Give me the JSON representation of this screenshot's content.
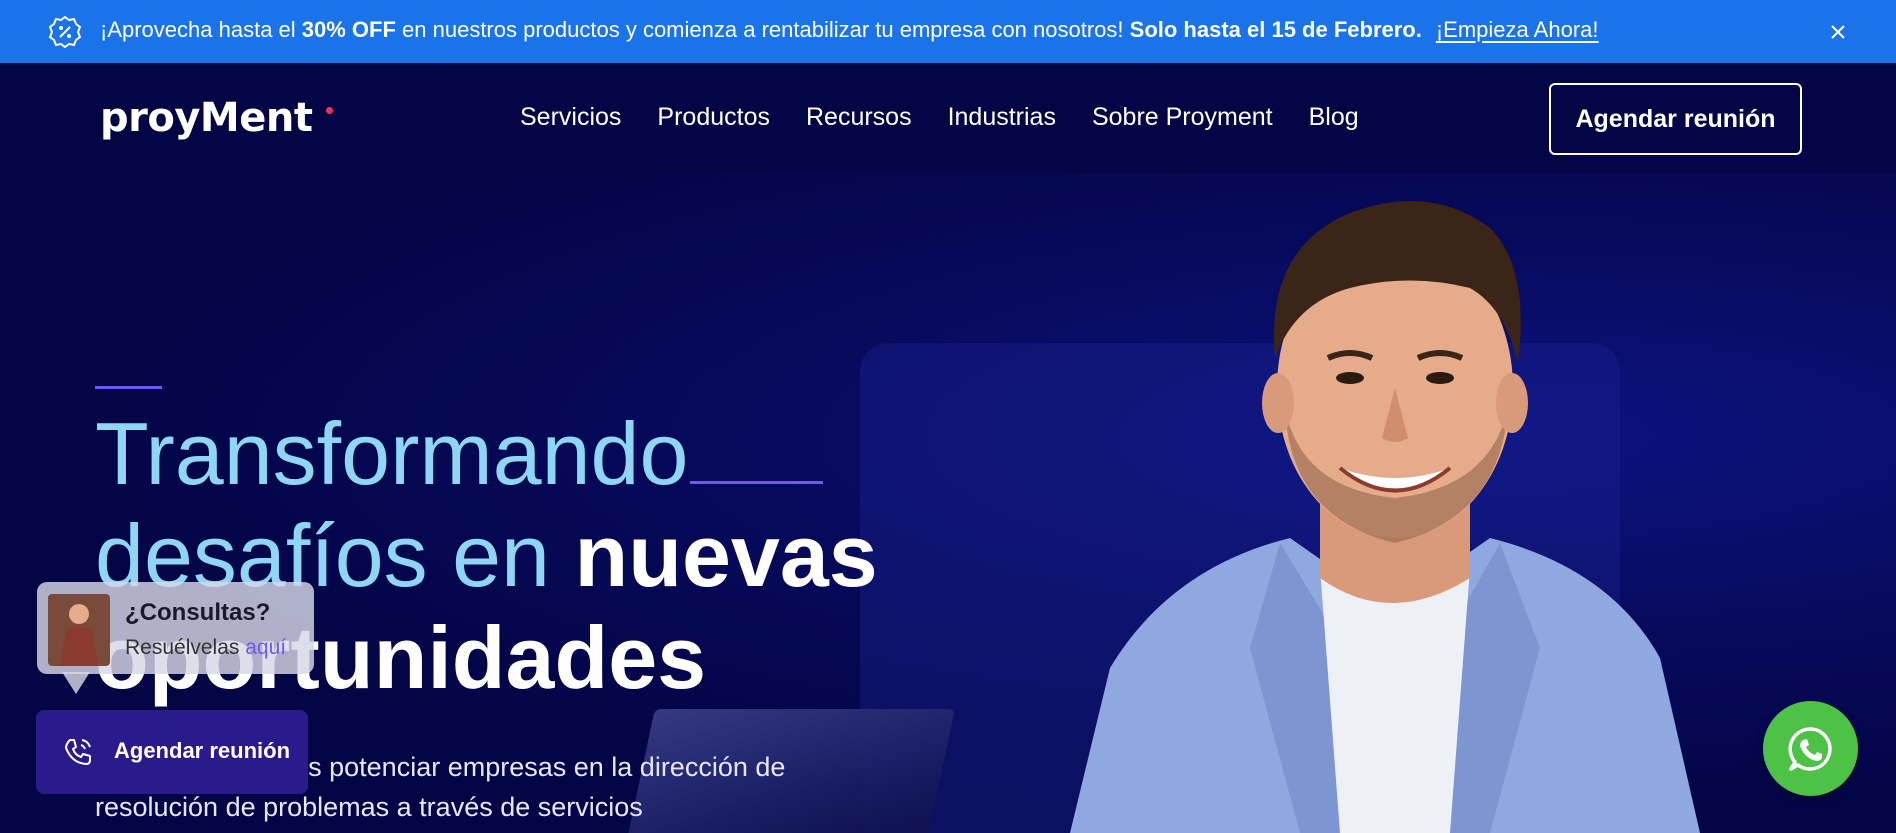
{
  "promo": {
    "icon": "discount-badge-icon",
    "text_pre": "¡Aprovecha hasta el ",
    "text_bold": "30% OFF",
    "text_mid": " en nuestros productos y comienza a rentabilizar tu empresa con nosotros! ",
    "text_deadline": "Solo hasta el 15 de Febrero.",
    "cta": "¡Empieza Ahora!",
    "close_icon": "close-icon",
    "background": "#1a73e8"
  },
  "header": {
    "logo": "proyMent",
    "nav": [
      "Servicios",
      "Productos",
      "Recursos",
      "Industrias",
      "Sobre Proyment",
      "Blog"
    ],
    "cta": "Agendar reunión",
    "background": "#030545"
  },
  "hero": {
    "title_line1": "Transformando",
    "title_line2_light": "desafíos en ",
    "title_line2_bold": "nuevas",
    "title_line3": "oportunidades",
    "description": "Nuestro desafío es potenciar empresas en la dirección de resolución de problemas a través de servicios",
    "accent_color": "#6c5ce7",
    "title_color": "#8fd6f5"
  },
  "widgets": {
    "consult_title": "¿Consultas?",
    "consult_sub": "Resuélvelas ",
    "consult_link": "aquí",
    "meet_label": "Agendar reunión",
    "meet_icon": "phone-icon",
    "whatsapp_icon": "whatsapp-icon",
    "whatsapp_color": "#4dc247"
  }
}
